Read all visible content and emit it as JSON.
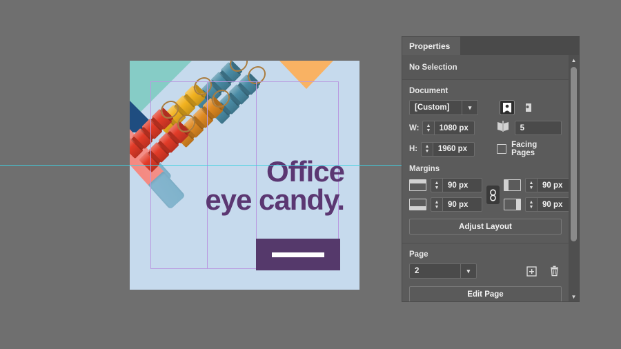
{
  "app": {
    "background_color": "#6f6f6f",
    "guide_color": "#3fd0e0",
    "margin_guide_color": "#b99ae0"
  },
  "artboard": {
    "background_color": "#c6daed",
    "headline_line1": "Office",
    "headline_line2": "eye candy.",
    "headline_color": "#5b3772",
    "button_color": "#55396b",
    "shapes": {
      "triangle_mint": "#86ccc6",
      "triangle_navy": "#1f4d80",
      "triangle_orange": "#f9b263",
      "eraser_top": "#f6877f",
      "eraser_bottom": "#86b6cf",
      "clip_red": "#e23b28",
      "clip_yellow": "#f2b21f",
      "clip_orange": "#e08a22",
      "clip_teal": "#4a8ca6"
    }
  },
  "panel": {
    "tab_label": "Properties",
    "selection_status": "No Selection",
    "document": {
      "section_label": "Document",
      "preset_value": "[Custom]",
      "orientation_portrait_icon": "portrait-icon",
      "orientation_landscape_icon": "landscape-icon",
      "width_label": "W:",
      "width_value": "1080 px",
      "height_label": "H:",
      "height_value": "1960 px",
      "pages_icon": "spread-pages-icon",
      "pages_value": "5",
      "facing_pages_label": "Facing Pages",
      "facing_pages_checked": false
    },
    "margins": {
      "section_label": "Margins",
      "top_value": "90 px",
      "bottom_value": "90 px",
      "left_value": "90 px",
      "right_value": "90 px",
      "link_icon": "chain-link-icon",
      "adjust_layout_label": "Adjust Layout"
    },
    "page": {
      "section_label": "Page",
      "current_page": "2",
      "add_page_icon": "add-page-icon",
      "delete_page_icon": "trash-icon",
      "edit_page_label": "Edit Page"
    },
    "scrollbar": {
      "up_icon": "chevron-up-icon",
      "down_icon": "chevron-down-icon"
    }
  }
}
